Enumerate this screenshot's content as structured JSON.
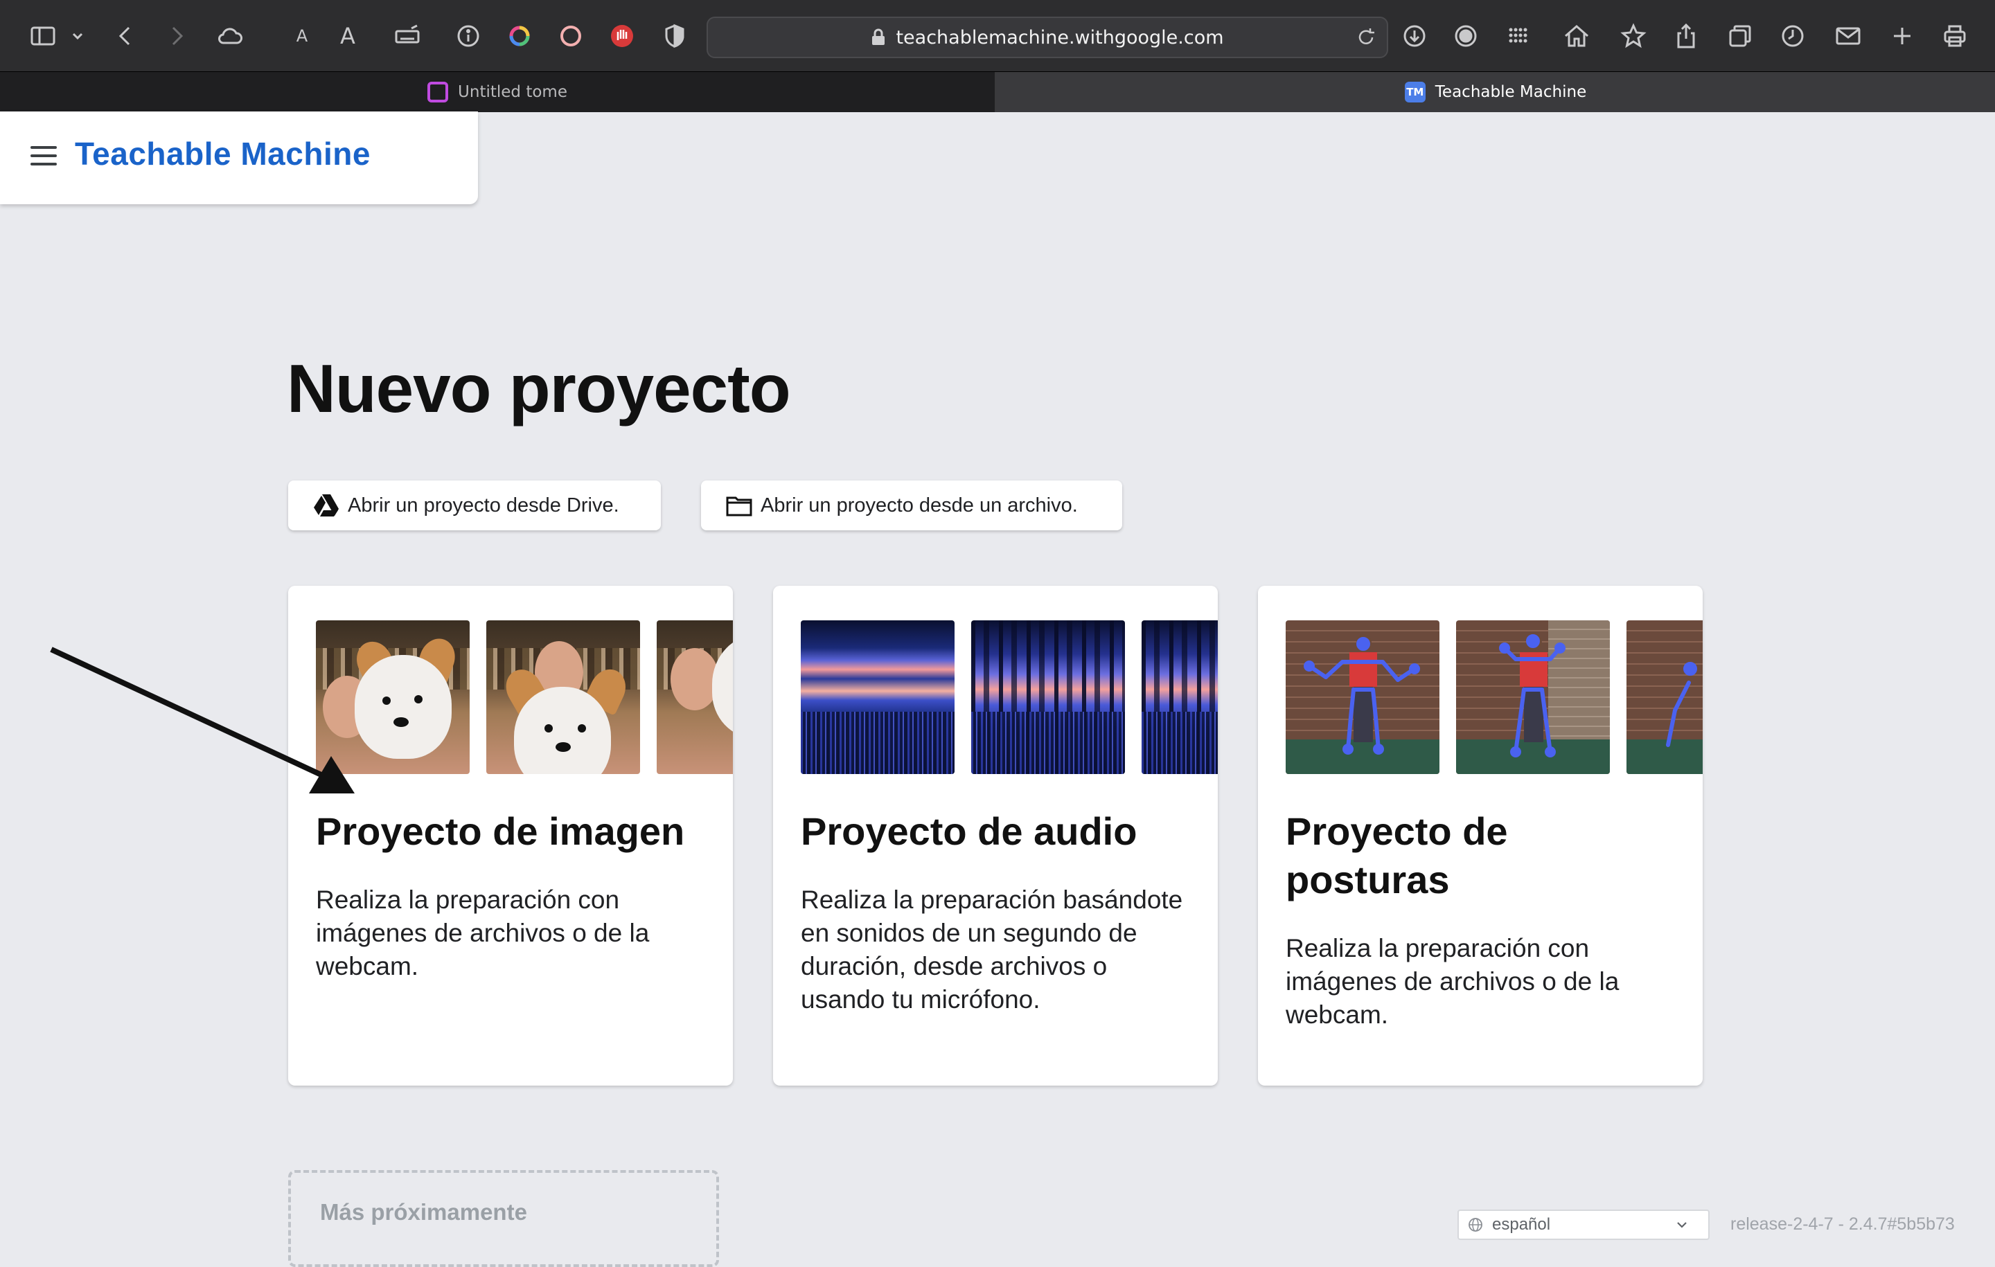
{
  "browser": {
    "url": "teachablemachine.withgoogle.com",
    "tabs": [
      {
        "label": "Untitled tome",
        "active": false
      },
      {
        "label": "Teachable Machine",
        "active": true
      }
    ],
    "reader_small_label": "A",
    "reader_large_label": "A",
    "tab_favicon_text": "TM",
    "toolbar_icons": [
      "sidebar-icon",
      "chevron-down-icon",
      "back-icon",
      "forward-icon",
      "cloud-icon",
      "text-smaller-icon",
      "text-larger-icon",
      "keyboard-icon",
      "info-icon",
      "color-ring-icon",
      "circle-icon",
      "hand-stop-icon",
      "shield-icon",
      "download-icon",
      "record-icon",
      "grid-icon",
      "home-icon",
      "star-icon",
      "share-icon",
      "tabs-icon",
      "history-icon",
      "mail-icon",
      "new-tab-icon",
      "print-icon"
    ]
  },
  "header": {
    "app_title": "Teachable Machine"
  },
  "main": {
    "page_title": "Nuevo proyecto",
    "open_drive_label": "Abrir un proyecto desde Drive.",
    "open_file_label": "Abrir un proyecto desde un archivo.",
    "cards": [
      {
        "title": "Proyecto de imagen",
        "description": "Realiza la preparación con imágenes de archivos o de la webcam."
      },
      {
        "title": "Proyecto de audio",
        "description": "Realiza la preparación basándote en sonidos de un segundo de duración, desde archivos o usando tu micrófono."
      },
      {
        "title": "Proyecto de posturas",
        "description": "Realiza la preparación con imágenes de archivos o de la webcam."
      }
    ],
    "coming_soon_label": "Más próximamente"
  },
  "footer": {
    "language": "español",
    "release": "release-2-4-7 - 2.4.7#5b5b73"
  },
  "colors": {
    "accent": "#1a63c9",
    "chrome_bg": "#2d2d2f",
    "page_bg": "#e9eaee"
  }
}
